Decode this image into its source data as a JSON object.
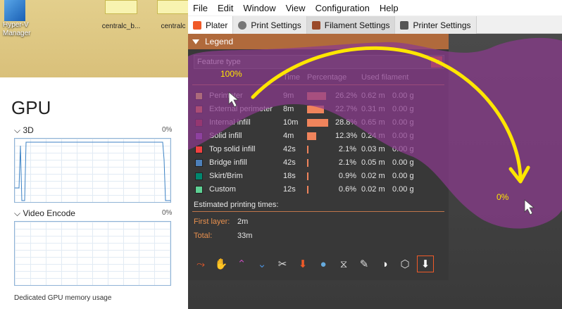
{
  "desktop": {
    "icons": [
      {
        "label": "Hyper-V Manager"
      },
      {
        "label": "centralc_b..."
      },
      {
        "label": "centralc"
      }
    ]
  },
  "taskmgr": {
    "title": "GPU",
    "sections": [
      {
        "label": "3D",
        "pct": "0%"
      },
      {
        "label": "Video Encode",
        "pct": "0%"
      }
    ],
    "memory_label": "Dedicated GPU memory usage"
  },
  "slicer": {
    "menu": [
      "File",
      "Edit",
      "Window",
      "View",
      "Configuration",
      "Help"
    ],
    "tabs": [
      {
        "label": "Plater",
        "color": "#f05a28"
      },
      {
        "label": "Print Settings",
        "color": "#777777"
      },
      {
        "label": "Filament Settings",
        "color": "#9a4a2a"
      },
      {
        "label": "Printer Settings",
        "color": "#555555"
      }
    ],
    "legend": {
      "title": "Legend",
      "feature_type": "Feature type",
      "columns": {
        "time": "Time",
        "percentage": "Percentage",
        "filament": "Used filament"
      },
      "rows": [
        {
          "name": "Perimeter",
          "time": "9m",
          "pct": "26.2%",
          "fraction": 0.262,
          "len": "0.62 m",
          "wt": "0.00 g",
          "color": "#ffe64d"
        },
        {
          "name": "External perimeter",
          "time": "8m",
          "pct": "22.7%",
          "fraction": 0.227,
          "len": "0.31 m",
          "wt": "0.00 g",
          "color": "#ff7d38"
        },
        {
          "name": "Internal infill",
          "time": "10m",
          "pct": "28.8%",
          "fraction": 0.288,
          "len": "0.65 m",
          "wt": "0.00 g",
          "color": "#b03029"
        },
        {
          "name": "Solid infill",
          "time": "4m",
          "pct": "12.3%",
          "fraction": 0.123,
          "len": "0.24 m",
          "wt": "0.00 g",
          "color": "#9654cc"
        },
        {
          "name": "Top solid infill",
          "time": "42s",
          "pct": "2.1%",
          "fraction": 0.021,
          "len": "0.03 m",
          "wt": "0.00 g",
          "color": "#f04040"
        },
        {
          "name": "Bridge infill",
          "time": "42s",
          "pct": "2.1%",
          "fraction": 0.021,
          "len": "0.05 m",
          "wt": "0.00 g",
          "color": "#4d80ba"
        },
        {
          "name": "Skirt/Brim",
          "time": "18s",
          "pct": "0.9%",
          "fraction": 0.009,
          "len": "0.02 m",
          "wt": "0.00 g",
          "color": "#00876e"
        },
        {
          "name": "Custom",
          "time": "12s",
          "pct": "0.6%",
          "fraction": 0.006,
          "len": "0.02 m",
          "wt": "0.00 g",
          "color": "#5ed194"
        }
      ],
      "estimated_label": "Estimated printing times:",
      "first_layer_label": "First layer:",
      "first_layer_value": "2m",
      "total_label": "Total:",
      "total_value": "33m"
    },
    "toolbar_icons": [
      "travel-icon",
      "wipe-icon",
      "retractions-icon",
      "deretractions-icon",
      "seams-icon",
      "tool-changes-icon",
      "color-changes-icon",
      "pause-prints-icon",
      "custom-gcodes-icon",
      "center-of-gravity-icon",
      "shells-icon",
      "tool-marker-icon"
    ]
  },
  "annotations": {
    "top_label": "100%",
    "bottom_label": "0%",
    "highlight_color": "#8b3a8e",
    "arrow_color": "#ffe600"
  }
}
